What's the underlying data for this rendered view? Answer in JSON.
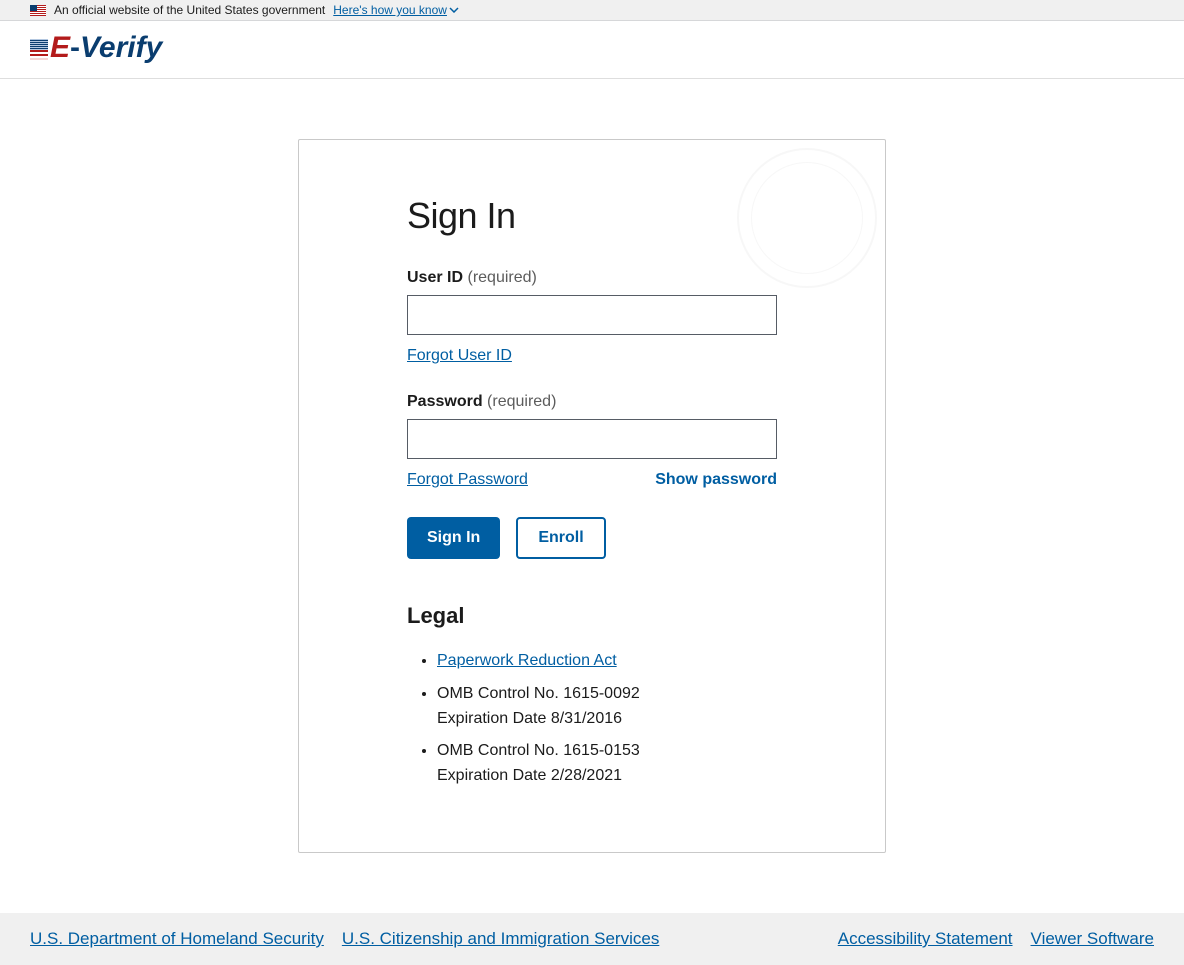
{
  "gov_banner": {
    "text": "An official website of the United States government",
    "link": "Here's how you know"
  },
  "logo": {
    "e": "E",
    "dash": "-",
    "verify": "Verify"
  },
  "signin": {
    "title": "Sign In",
    "userid_label": "User ID",
    "userid_req": "(required)",
    "userid_value": "",
    "forgot_userid": "Forgot User ID",
    "password_label": "Password",
    "password_req": "(required)",
    "password_value": "",
    "forgot_password": "Forgot Password",
    "show_password": "Show password",
    "signin_button": "Sign In",
    "enroll_button": "Enroll"
  },
  "legal": {
    "title": "Legal",
    "paperwork_link": "Paperwork Reduction Act",
    "omb1_line1": "OMB Control No. 1615-0092",
    "omb1_line2": "Expiration Date 8/31/2016",
    "omb2_line1": "OMB Control No. 1615-0153",
    "omb2_line2": "Expiration Date 2/28/2021"
  },
  "footer": {
    "dhs": "U.S. Department of Homeland Security",
    "uscis": "U.S. Citizenship and Immigration Services",
    "accessibility": "Accessibility Statement",
    "viewer": "Viewer Software"
  }
}
